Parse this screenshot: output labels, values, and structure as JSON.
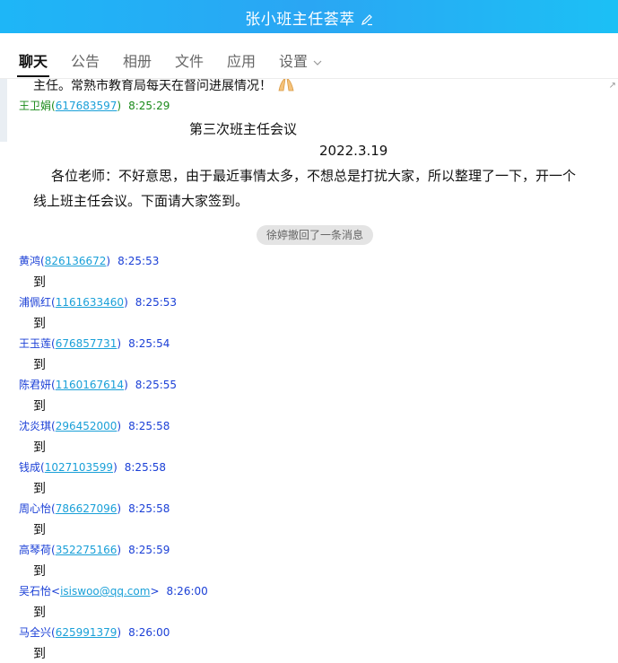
{
  "window": {
    "title": "张小班主任荟萃"
  },
  "tabs": [
    {
      "label": "聊天"
    },
    {
      "label": "公告"
    },
    {
      "label": "相册"
    },
    {
      "label": "文件"
    },
    {
      "label": "应用"
    },
    {
      "label": "设置"
    }
  ],
  "chat": {
    "partial_text": "主任。常熟市教育局每天在督问进展情况！",
    "announcement": {
      "sender": "王卫娟",
      "qq": "617683597",
      "time": "8:25:29",
      "title": "第三次班主任会议",
      "date": "2022.3.19",
      "body_line1": "各位老师：不好意思，由于最近事情太多，不想总是打扰大家，所以整理了一下，开一个",
      "body_line2": "线上班主任会议。下面请大家签到。"
    },
    "recall_notice": "徐婷撤回了一条消息",
    "messages": [
      {
        "sender": "黄鸿",
        "open": "(",
        "qq": "826136672",
        "close": ")",
        "time": "8:25:53",
        "text": "到"
      },
      {
        "sender": "浦佩红",
        "open": "(",
        "qq": "1161633460",
        "close": ")",
        "time": "8:25:53",
        "text": "到"
      },
      {
        "sender": "王玉莲",
        "open": "(",
        "qq": "676857731",
        "close": ")",
        "time": "8:25:54",
        "text": "到"
      },
      {
        "sender": "陈君妍",
        "open": "(",
        "qq": "1160167614",
        "close": ")",
        "time": "8:25:55",
        "text": "到"
      },
      {
        "sender": "沈炎琪",
        "open": "(",
        "qq": "296452000",
        "close": ")",
        "time": "8:25:58",
        "text": "到"
      },
      {
        "sender": "钱成",
        "open": "(",
        "qq": "1027103599",
        "close": ")",
        "time": "8:25:58",
        "text": "到"
      },
      {
        "sender": "周心怡",
        "open": "(",
        "qq": "786627096",
        "close": ")",
        "time": "8:25:58",
        "text": "到"
      },
      {
        "sender": "高琴荷",
        "open": "(",
        "qq": "352275166",
        "close": ")",
        "time": "8:25:59",
        "text": "到"
      },
      {
        "sender": "吴石怡",
        "open": "<",
        "qq": "isiswoo@qq.com",
        "close": ">",
        "time": "8:26:00",
        "text": "到"
      },
      {
        "sender": "马全兴",
        "open": "(",
        "qq": "625991379",
        "close": ")",
        "time": "8:26:00",
        "text": "到"
      }
    ]
  },
  "colors": {
    "titlebar": "#22aef5",
    "sender_blue": "#1a3fd6",
    "sender_green": "#1a8a1a",
    "link": "#1aa0d8"
  }
}
